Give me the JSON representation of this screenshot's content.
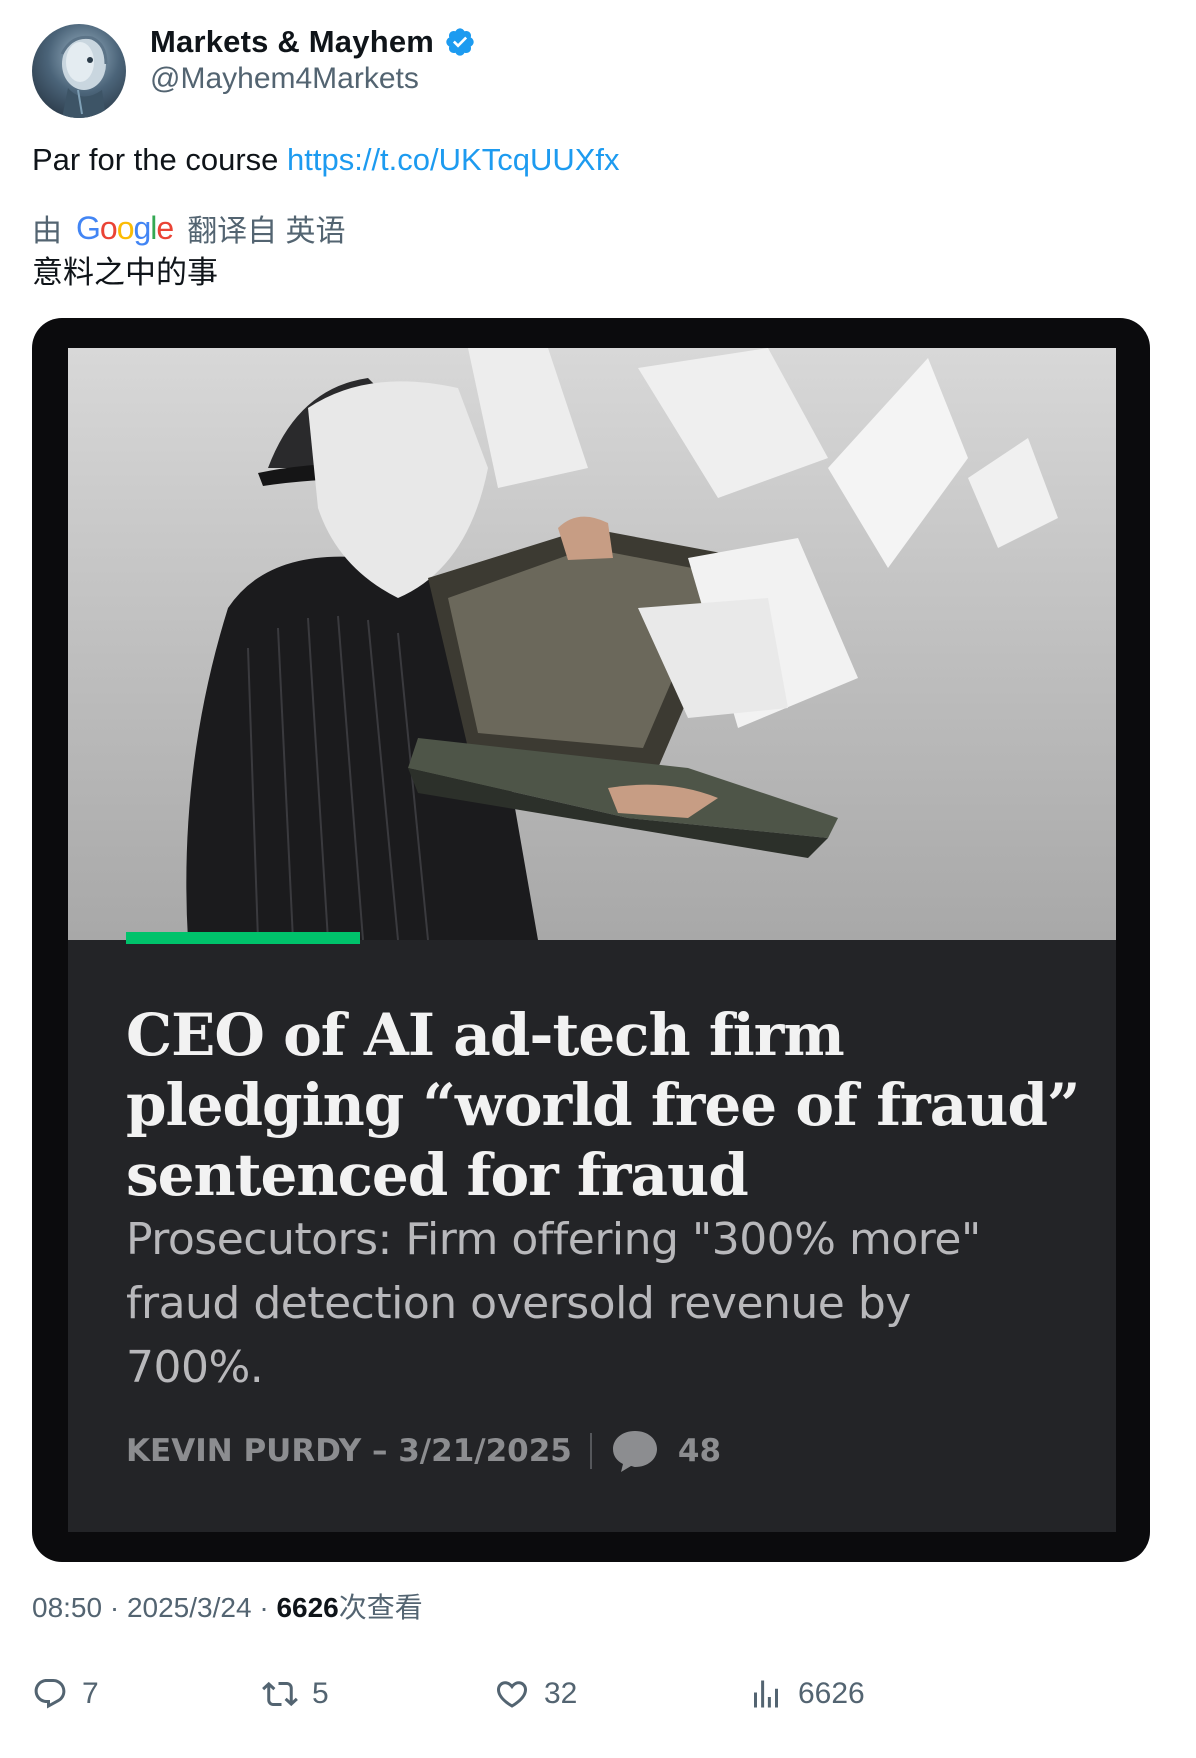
{
  "author": {
    "display_name": "Markets & Mayhem",
    "handle": "@Mayhem4Markets",
    "verified": true,
    "avatar_icon": "robot-head-avatar"
  },
  "tweet": {
    "text": "Par for the course ",
    "link": "https://t.co/UKTcqUUXfx",
    "translation": {
      "by_label": "由",
      "google_letters": [
        "G",
        "o",
        "o",
        "g",
        "l",
        "e"
      ],
      "from_label": "翻译自 英语",
      "translated_text": "意料之中的事"
    }
  },
  "card": {
    "headline": "CEO of AI ad-tech firm pledging “world free of fraud” sentenced for fraud",
    "subhead": "Prosecutors: Firm offering \"300% more\" fraud detection oversold revenue by 700%.",
    "byline": "KEVIN PURDY – 3/21/2025",
    "comment_count": "48",
    "accent_color": "#00c26b",
    "image_description_icon": "man-with-briefcase-papers-photo"
  },
  "meta": {
    "time": "08:50",
    "separator": "·",
    "date": "2025/3/24",
    "views": "6626",
    "views_label": "次查看"
  },
  "actions": {
    "reply": "7",
    "retweet": "5",
    "like": "32",
    "views": "6626"
  },
  "colors": {
    "link": "#1d9bf0",
    "secondary_text": "#536471",
    "verified": "#1d9bf0"
  }
}
